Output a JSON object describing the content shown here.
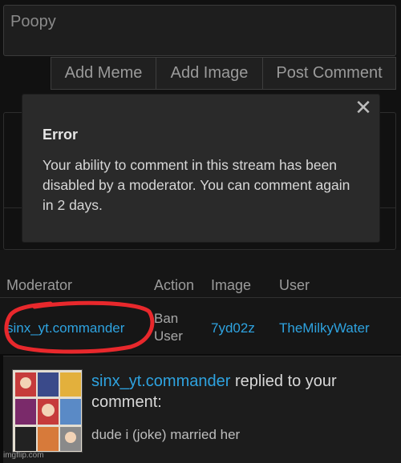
{
  "comment_box": {
    "value": "Poopy"
  },
  "buttons": {
    "add_meme": "Add Meme",
    "add_image": "Add Image",
    "post_comment": "Post Comment"
  },
  "dialog": {
    "title": "Error",
    "message": "Your ability to comment in this stream has been disabled by a moderator. You can comment again in 2 days.",
    "close_icon": "close-icon"
  },
  "log": {
    "headers": [
      "Moderator",
      "Action",
      "Image",
      "User"
    ],
    "row": {
      "moderator": "sinx_yt.commander",
      "action": "Ban User",
      "image": "7yd02z",
      "user": "TheMilkyWater"
    }
  },
  "notification": {
    "user": "sinx_yt.commander",
    "text": "replied to your comment:",
    "body": "dude i (joke) married her"
  },
  "watermark": "imgflip.com",
  "colors": {
    "link": "#2ea3e0",
    "annotation": "#e8282c"
  }
}
